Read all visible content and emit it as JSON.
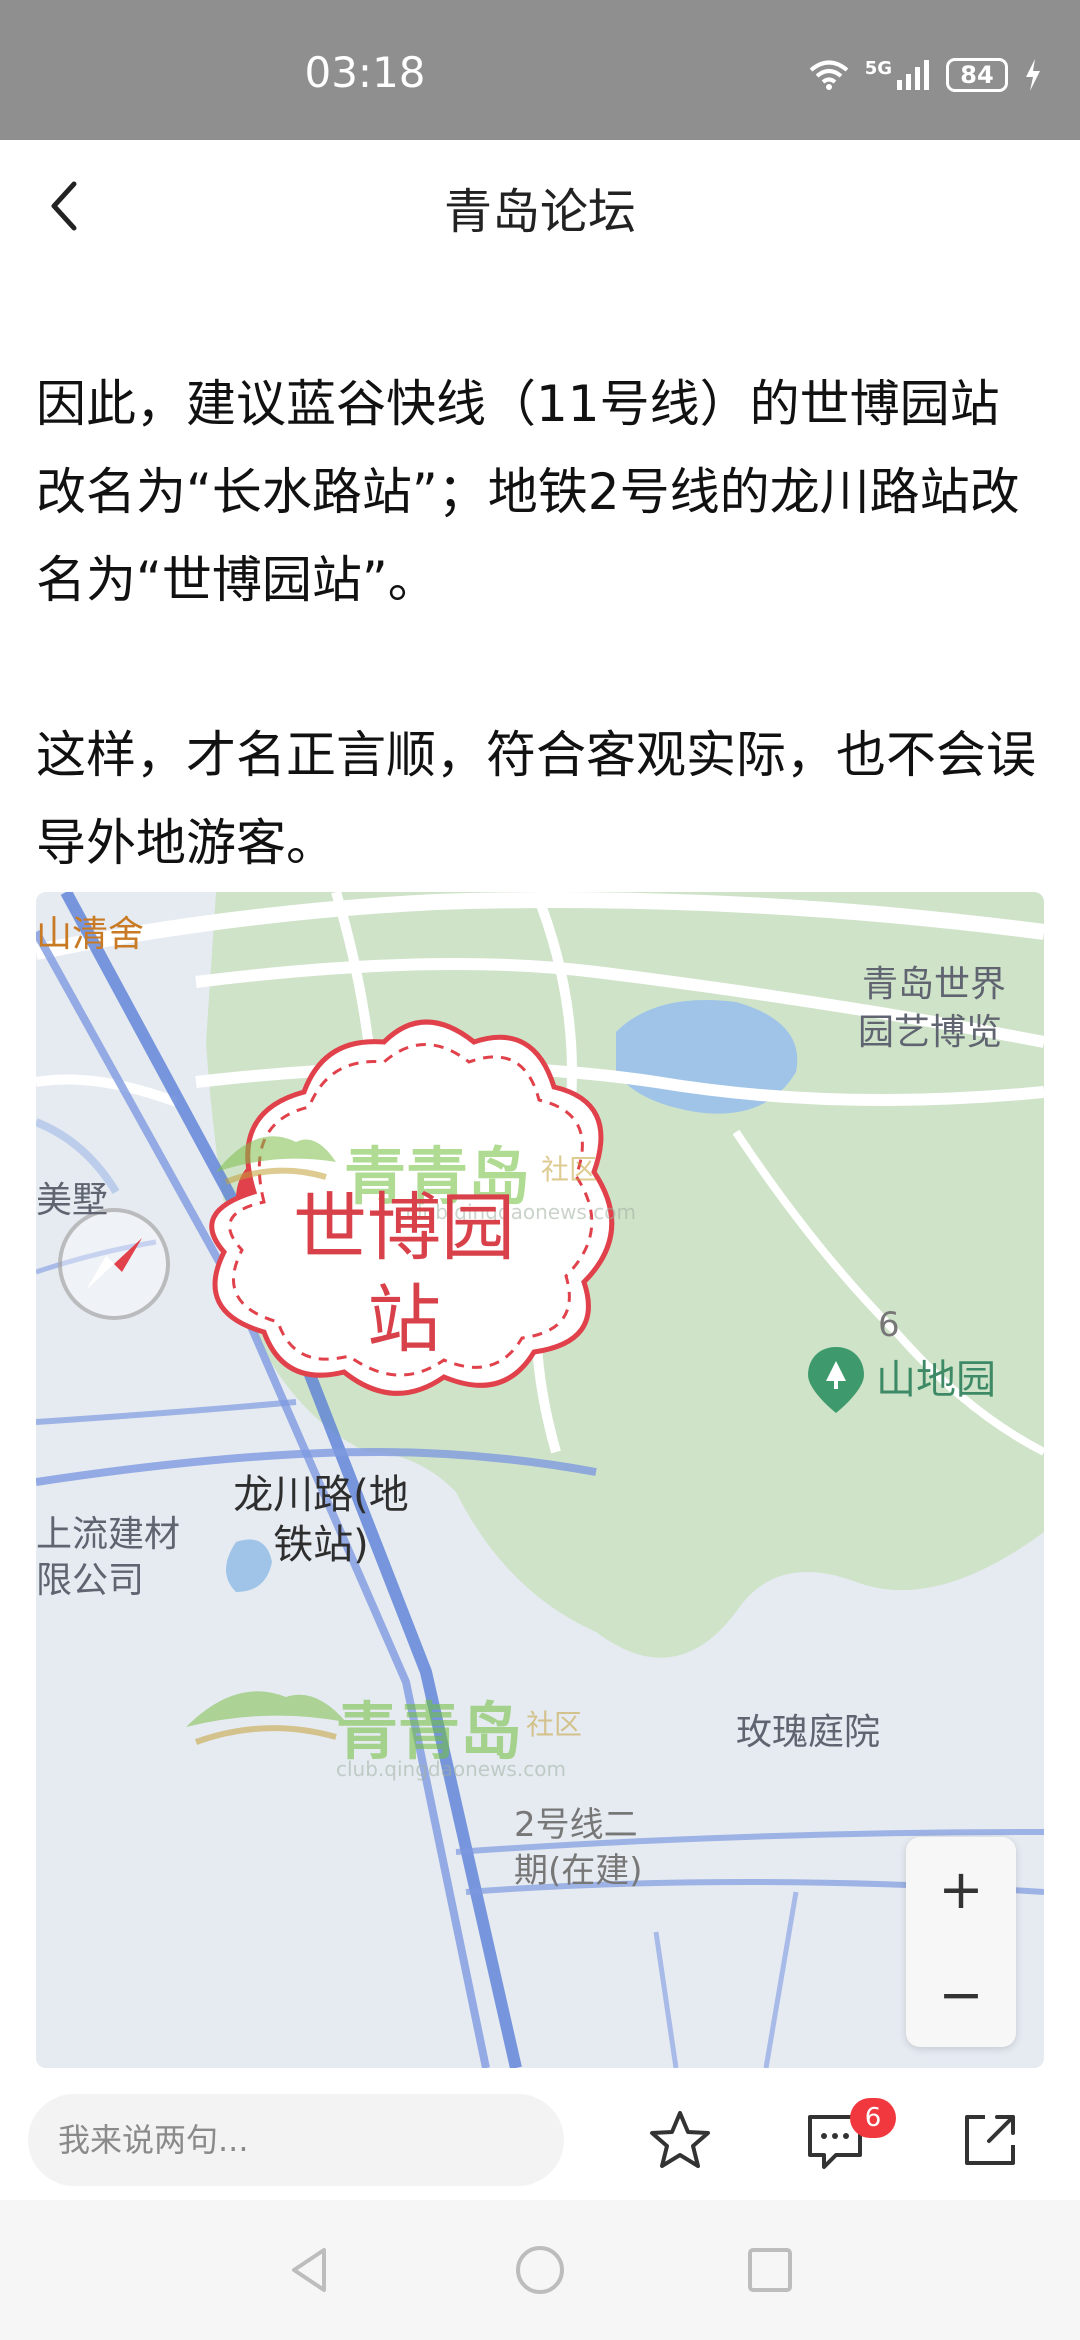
{
  "status_bar": {
    "time": "03:18",
    "network": "5G",
    "battery": "84"
  },
  "header": {
    "title": "青岛论坛"
  },
  "article": {
    "paragraphs": [
      "因此，建议蓝谷快线（11号线）的世博园站改名为“长水路站”；地铁2号线的龙川路站改名为“世博园站”。",
      "这样，才名正言顺，符合客观实际，也不会误导外地游客。"
    ]
  },
  "map": {
    "labels": {
      "shanqingshe": "山清舍",
      "expo_line1": "青岛世界",
      "expo_line2": "园艺博览",
      "meishu": "美墅",
      "shandiyuan": "山地园",
      "longchuan_line1": "龙川路(地",
      "longchuan_line2": "铁站)",
      "shangliu_line1": "上流建材",
      "shangliu_line2": "限公司",
      "meigui": "玫瑰庭院",
      "line2_line1": "2号线二",
      "line2_line2": "期(在建)",
      "road_number": "6"
    },
    "callout_line1": "世博园",
    "callout_line2": "站",
    "watermark": {
      "name": "青青岛",
      "sub": "社区",
      "url": "club.qingdaonews.com"
    },
    "zoom": {
      "in": "+",
      "out": "−"
    }
  },
  "bottom_bar": {
    "comment_placeholder": "我来说两句...",
    "comment_count": "6"
  },
  "colors": {
    "accent_red": "#e0414a",
    "park_green": "#cfe3c9",
    "water_blue": "#9fc4e8"
  }
}
